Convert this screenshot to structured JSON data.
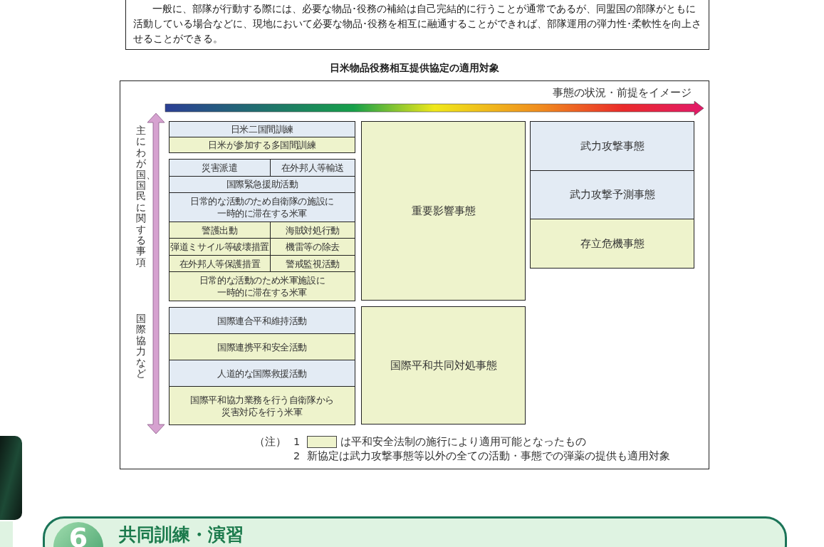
{
  "intro_text": "一般に、部隊が行動する際には、必要な物品･役務の補給は自己完結的に行うことが通常であるが、同盟国の部隊がともに活動している場合などに、現地において必要な物品･役務を相互に融通することができれば、部隊運用の弾力性･柔軟性を向上させることができる。",
  "figure": {
    "title": "日米物品役務相互提供協定の適用対象",
    "horizontal_axis": "事態の状況・前提をイメージ",
    "vertical_labels": [
      "主にわが国、国民に関する事項",
      "国際協力など"
    ],
    "left_groups": [
      {
        "rows": [
          {
            "cells": [
              {
                "text": "日米二国間訓練",
                "newly_applicable": false
              }
            ]
          },
          {
            "cells": [
              {
                "text": "日米が参加する多国間訓練",
                "newly_applicable": true
              }
            ]
          }
        ]
      },
      {
        "rows": [
          {
            "cells": [
              {
                "text": "災害派遣",
                "newly_applicable": false
              },
              {
                "text": "在外邦人等輸送",
                "newly_applicable": false
              }
            ]
          },
          {
            "cells": [
              {
                "text": "国際緊急援助活動",
                "newly_applicable": false
              }
            ]
          },
          {
            "cells": [
              {
                "text": "日常的な活動のため自衛隊の施設に一時的に滞在する米軍",
                "newly_applicable": false
              }
            ]
          },
          {
            "cells": [
              {
                "text": "警護出動",
                "newly_applicable": true
              },
              {
                "text": "海賊対処行動",
                "newly_applicable": true
              }
            ]
          },
          {
            "cells": [
              {
                "text": "弾道ミサイル等破壊措置",
                "newly_applicable": true
              },
              {
                "text": "機雷等の除去",
                "newly_applicable": true
              }
            ]
          },
          {
            "cells": [
              {
                "text": "在外邦人等保護措置",
                "newly_applicable": true
              },
              {
                "text": "警戒監視活動",
                "newly_applicable": true
              }
            ]
          },
          {
            "cells": [
              {
                "text": "日常的な活動のため米軍施設に一時的に滞在する米軍",
                "newly_applicable": true
              }
            ]
          }
        ]
      },
      {
        "rows": [
          {
            "cells": [
              {
                "text": "国際連合平和維持活動",
                "newly_applicable": false
              }
            ]
          },
          {
            "cells": [
              {
                "text": "国際連携平和安全活動",
                "newly_applicable": true
              }
            ]
          },
          {
            "cells": [
              {
                "text": "人道的な国際救援活動",
                "newly_applicable": false
              }
            ]
          },
          {
            "cells": [
              {
                "text": "国際平和協力業務を行う自衛隊から災害対応を行う米軍",
                "newly_applicable": true
              }
            ]
          }
        ]
      }
    ],
    "middle_cells": [
      {
        "text": "重要影響事態",
        "newly_applicable": true
      },
      {
        "text": "国際平和共同対処事態",
        "newly_applicable": true
      }
    ],
    "right_cells": [
      {
        "text": "武力攻撃事態",
        "newly_applicable": false
      },
      {
        "text": "武力攻撃予測事態",
        "newly_applicable": false
      },
      {
        "text": "存立危機事態",
        "newly_applicable": true
      }
    ],
    "notes_label": "（注）",
    "notes": [
      {
        "number": "1",
        "kind": "swatch",
        "text": "は平和安全法制の施行により適用可能となったもの"
      },
      {
        "number": "2",
        "kind": "plain",
        "text": "新協定は武力攻撃事態等以外の全ての活動・事態での弾薬の提供も適用対象"
      }
    ]
  },
  "section_header": {
    "number": "6",
    "title": "共同訓練・演習"
  }
}
